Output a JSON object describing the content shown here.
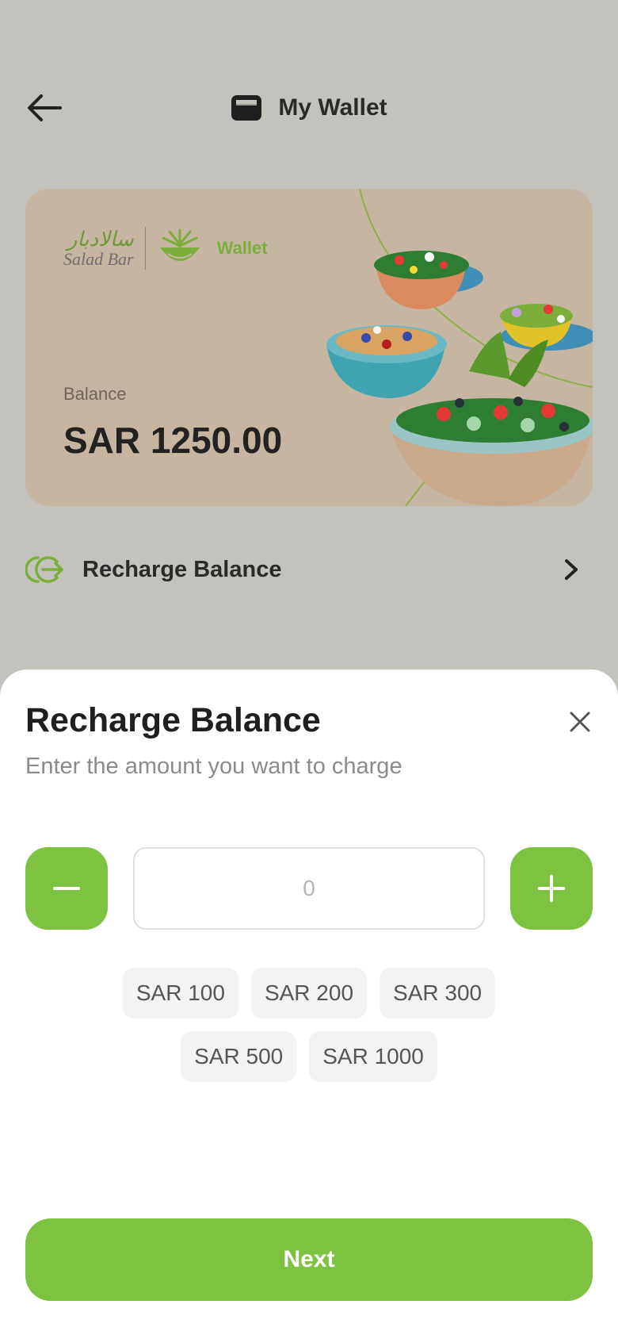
{
  "header": {
    "title": "My Wallet",
    "back_icon": "arrow-left-icon",
    "title_icon": "wallet-icon"
  },
  "card": {
    "logo_arabic": "سالادبار",
    "logo_english": "Salad Bar",
    "logo_wallet": "Wallet",
    "balance_label": "Balance",
    "balance_value": "SAR 1250.00",
    "background_color": "#c6b6a1"
  },
  "recharge_row": {
    "label": "Recharge Balance",
    "icon": "recharge-icon",
    "chevron_icon": "chevron-right-icon"
  },
  "sheet": {
    "title": "Recharge Balance",
    "subtitle": "Enter the amount you want to charge",
    "close_icon": "close-icon",
    "amount": {
      "value": "",
      "placeholder": "0"
    },
    "minus_icon": "minus-icon",
    "plus_icon": "plus-icon",
    "quick_amounts_row1": [
      "SAR 100",
      "SAR 200",
      "SAR 300"
    ],
    "quick_amounts_row2": [
      "SAR 500",
      "SAR 1000"
    ],
    "next_label": "Next"
  },
  "colors": {
    "accent": "#7ec242",
    "overlay": "#c3c2bd",
    "text": "#1f1f1f"
  }
}
